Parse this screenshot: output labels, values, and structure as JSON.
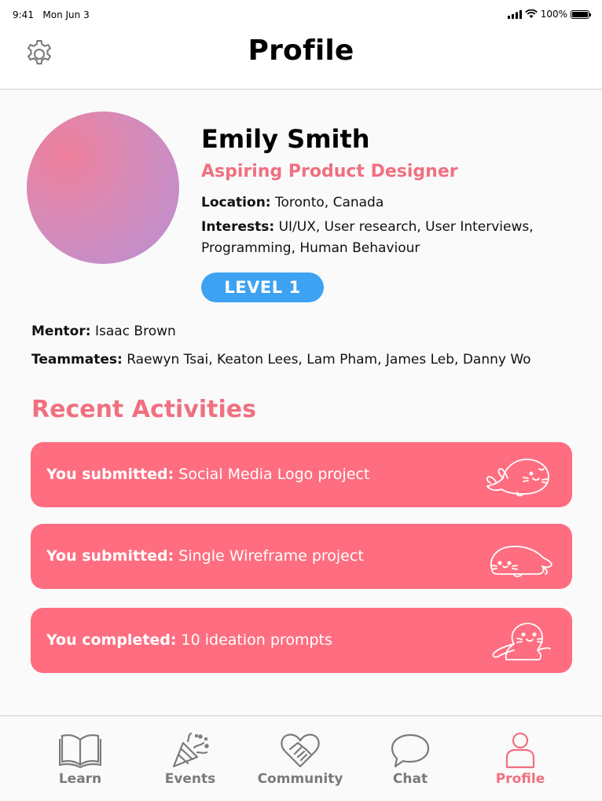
{
  "status_bar": {
    "time": "9:41",
    "date": "Mon Jun 3",
    "battery": "100%",
    "battery_level": 1.0
  },
  "header": {
    "title": "Profile",
    "settings_icon": "gear-icon"
  },
  "profile": {
    "name": "Emily Smith",
    "role": "Aspiring Product Designer",
    "location_label": "Location:",
    "location": "Toronto, Canada",
    "interests_label": "Interests:",
    "interests": "UI/UX, User research, User Interviews, Programming, Human Behaviour",
    "level": "LEVEL 1",
    "mentor_label": "Mentor:",
    "mentor": "Isaac Brown",
    "teammates_label": "Teammates:",
    "teammates": "Raewyn Tsai, Keaton Lees, Lam Pham, James Leb, Danny Wo"
  },
  "activities": {
    "title": "Recent Activities",
    "items": [
      {
        "label": "You submitted:",
        "text": "Social Media Logo project",
        "icon": "seal-waving-icon"
      },
      {
        "label": "You submitted:",
        "text": "Single Wireframe project",
        "icon": "seal-lying-icon"
      },
      {
        "label": "You completed:",
        "text": "10 ideation prompts",
        "icon": "seal-sitting-icon"
      }
    ]
  },
  "tabs": [
    {
      "label": "Learn",
      "icon": "book-icon",
      "active": false
    },
    {
      "label": "Events",
      "icon": "party-popper-icon",
      "active": false
    },
    {
      "label": "Community",
      "icon": "heart-handshake-icon",
      "active": false
    },
    {
      "label": "Chat",
      "icon": "chat-bubble-icon",
      "active": false
    },
    {
      "label": "Profile",
      "icon": "person-icon",
      "active": true
    }
  ],
  "colors": {
    "accent": "#f07080",
    "card": "#fe6e80",
    "badge": "#3ea2f2",
    "tab_inactive": "#7a7a7a"
  }
}
